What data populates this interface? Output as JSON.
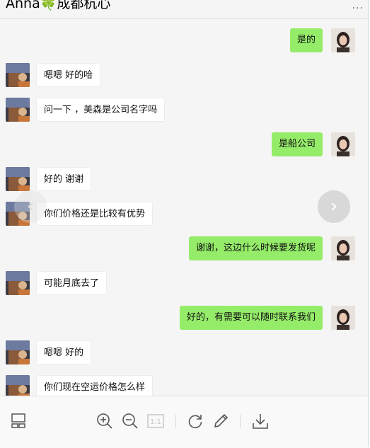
{
  "header": {
    "title": "Anna🍀成都杭心",
    "more": "···"
  },
  "messages": [
    {
      "side": "right",
      "text": "是的"
    },
    {
      "side": "left",
      "text": "嗯嗯 好的哈"
    },
    {
      "side": "left",
      "text": "问一下 ，美森是公司名字吗"
    },
    {
      "side": "right",
      "text": "是船公司"
    },
    {
      "side": "left",
      "text": "好的  谢谢"
    },
    {
      "side": "left",
      "text": "你们价格还是比较有优势"
    },
    {
      "side": "right",
      "text": "谢谢，这边什么时候要发货呢"
    },
    {
      "side": "left",
      "text": "可能月底去了"
    },
    {
      "side": "right",
      "text": "好的，有需要可以随时联系我们"
    },
    {
      "side": "left",
      "text": "嗯嗯 好的"
    },
    {
      "side": "left",
      "text": "你们现在空运价格怎么样"
    }
  ],
  "nav": {
    "prev": "‹",
    "next": "›"
  },
  "toolbar": {
    "actual_size_label": "1:1"
  },
  "colors": {
    "sent_bubble": "#95ec69",
    "received_bubble": "#ffffff",
    "background": "#f5f5f5"
  }
}
